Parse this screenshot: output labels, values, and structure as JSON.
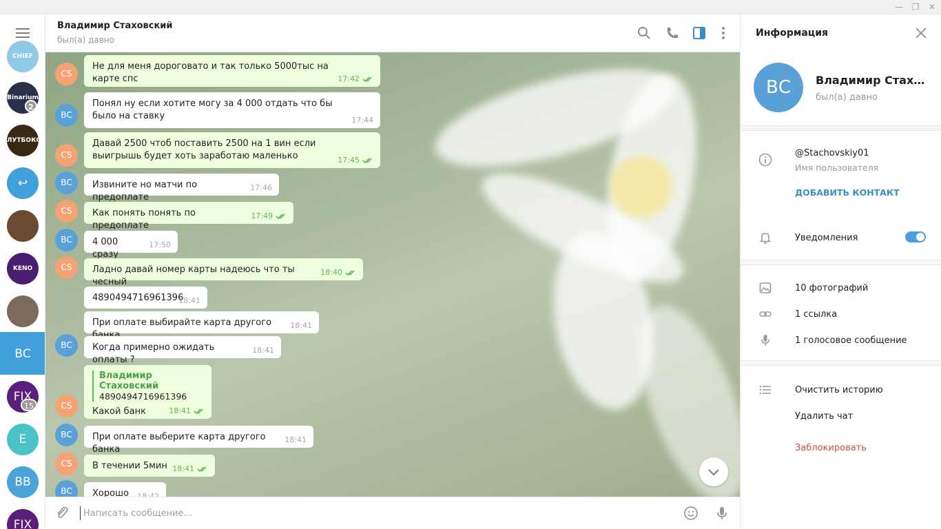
{
  "window": {
    "min": "—",
    "max": "❐",
    "close": "✕"
  },
  "sidebar": {
    "chats": [
      {
        "initials": "CHIEF",
        "color": "#8fc9e6",
        "badge": ""
      },
      {
        "initials": "Binarium",
        "color": "#2a2f4a",
        "badge": "2"
      },
      {
        "initials": "ЛУТБОКС",
        "color": "#3a2a14",
        "badge": ""
      },
      {
        "initials": "↩",
        "color": "#419fd9",
        "badge": ""
      },
      {
        "initials": "",
        "color": "#6b4a30",
        "badge": ""
      },
      {
        "initials": "KENO",
        "color": "#4a1e6e",
        "badge": ""
      },
      {
        "initials": "",
        "color": "#7a6b5b",
        "badge": ""
      },
      {
        "initials": "ВС",
        "color": "#419fd9",
        "badge": ""
      },
      {
        "initials": "FIX",
        "color": "#5a1f7a",
        "badge": "15"
      },
      {
        "initials": "E",
        "color": "#4bc1c8",
        "badge": ""
      },
      {
        "initials": "BB",
        "color": "#4aa3d9",
        "badge": ""
      },
      {
        "initials": "FIX",
        "color": "#5a1f7a",
        "badge": ""
      }
    ]
  },
  "header": {
    "title": "Владимир Стаховский",
    "status": "был(а) давно"
  },
  "messages": [
    {
      "avatar": "CS",
      "text": "Не для меня дороговато и так только 5000тыс на карте спс",
      "time": "17:42",
      "out": true
    },
    {
      "avatar": "ВС",
      "text": "Понял ну если хотите могу за 4 000  отдать  что бы было на ставку",
      "time": "17:44",
      "out": false
    },
    {
      "avatar": "CS",
      "text": "Давай 2500 чтоб поставить 2500 на 1 вин если выигрышь будет хоть заработаю маленько",
      "time": "17:45",
      "out": true
    },
    {
      "avatar": "ВС",
      "text": "Извините но матчи по предоплате",
      "time": "17:46",
      "out": false
    },
    {
      "avatar": "CS",
      "text": "Как понять понять по предоплате",
      "time": "17:49",
      "out": true
    },
    {
      "avatar": "ВС",
      "text": "4 000 сразу",
      "time": "17:50",
      "out": false
    },
    {
      "avatar": "CS",
      "text": "Ладно давай номер карты надеюсь что ты чесный",
      "time": "18:40",
      "out": true
    },
    {
      "avatar": "",
      "text": "4890494716961396",
      "time": "18:41",
      "out": false
    },
    {
      "avatar": "",
      "text": "При оплате выбирайте карта другого банка",
      "time": "18:41",
      "out": false
    },
    {
      "avatar": "ВС",
      "text": "Когда примерно ожидать оплаты ?",
      "time": "18:41",
      "out": false
    },
    {
      "avatar": "CS",
      "reply_name": "Владимир Стаховский",
      "reply_text": "4890494716961396",
      "text": "Какой банк",
      "time": "18:41",
      "out": true
    },
    {
      "avatar": "ВС",
      "text": "При оплате выберите карта другого банка",
      "time": "18:41",
      "out": false
    },
    {
      "avatar": "CS",
      "text": "В течении 5мин",
      "time": "18:41",
      "out": true
    },
    {
      "avatar": "ВС",
      "text": "Хорошо",
      "time": "18:42",
      "out": false
    }
  ],
  "composer": {
    "placeholder": "Написать сообщение..."
  },
  "info": {
    "title": "Информация",
    "avatar": "ВС",
    "name": "Владимир Стаховский",
    "status": "был(а) давно",
    "username": "@Stachovskiy01",
    "username_label": "Имя пользователя",
    "add_contact": "ДОБАВИТЬ КОНТАКТ",
    "notifications": "Уведомления",
    "notifications_on": true,
    "photos": "10 фотографий",
    "links": "1 ссылка",
    "voice": "1 голосовое сообщение",
    "clear_history": "Очистить историю",
    "delete_chat": "Удалить чат",
    "block": "Заблокировать"
  },
  "colors": {
    "accent": "#419fd9",
    "outgoing": "#eeffde",
    "danger": "#d14e4e"
  }
}
